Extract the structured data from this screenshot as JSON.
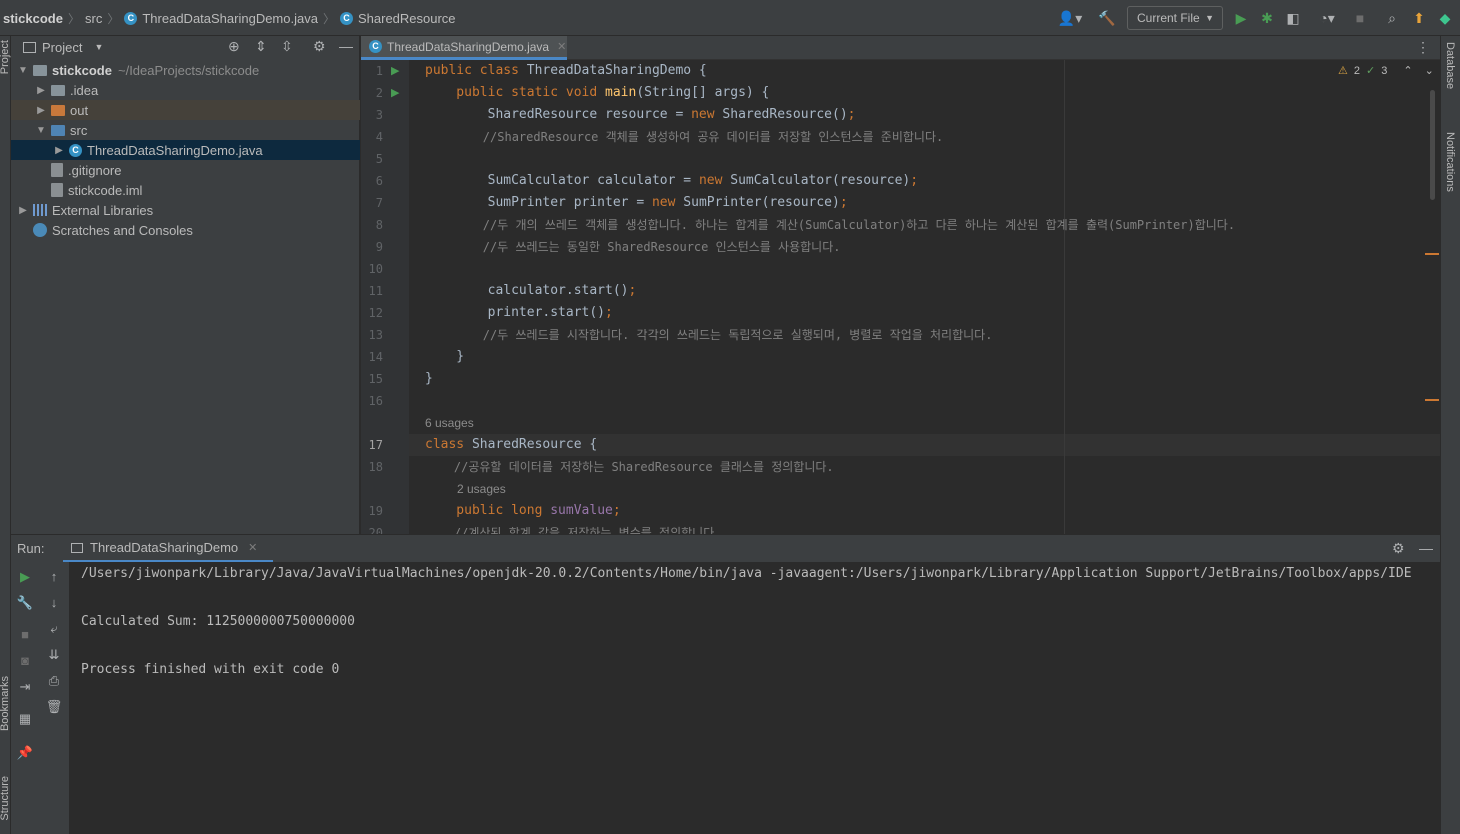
{
  "nav": {
    "project": "stickcode",
    "src": "src",
    "file": "ThreadDataSharingDemo.java",
    "symbol": "SharedResource",
    "run_config": "Current File"
  },
  "left_stripe": {
    "project": "Project",
    "bookmarks": "Bookmarks",
    "structure": "Structure"
  },
  "right_stripe": {
    "database": "Database",
    "notifications": "Notifications"
  },
  "project_panel": {
    "title": "Project",
    "tree": [
      {
        "label": "stickcode",
        "path": "~/IdeaProjects/stickcode"
      },
      {
        "label": ".idea"
      },
      {
        "label": "out"
      },
      {
        "label": "src"
      },
      {
        "label": "ThreadDataSharingDemo.java"
      },
      {
        "label": ".gitignore"
      },
      {
        "label": "stickcode.iml"
      },
      {
        "label": "External Libraries"
      },
      {
        "label": "Scratches and Consoles"
      }
    ]
  },
  "editor": {
    "tab": "ThreadDataSharingDemo.java",
    "warnings": "2",
    "checks": "3",
    "line_numbers": [
      "1",
      "2",
      "3",
      "4",
      "5",
      "6",
      "7",
      "8",
      "9",
      "10",
      "11",
      "12",
      "13",
      "14",
      "15",
      "16",
      "17",
      "18",
      "19",
      "20"
    ],
    "usages_6": "6 usages",
    "usages_2": "2 usages",
    "code": {
      "l1a": "public class ",
      "l1b": "ThreadDataSharingDemo {",
      "l2a": "    public static void ",
      "l2b": "main",
      "l2c": "(String[] args) {",
      "l3a": "        SharedResource resource = ",
      "l3b": "new ",
      "l3c": "SharedResource()",
      "l3d": ";",
      "l4": "        //SharedResource 객체를 생성하여 공유 데이터를 저장할 인스턴스를 준비합니다.",
      "l6a": "        SumCalculator calculator = ",
      "l6b": "new ",
      "l6c": "SumCalculator(resource)",
      "l6d": ";",
      "l7a": "        SumPrinter printer = ",
      "l7b": "new ",
      "l7c": "SumPrinter(resource)",
      "l7d": ";",
      "l8": "        //두 개의 쓰레드 객체를 생성합니다. 하나는 합계를 계산(SumCalculator)하고 다른 하나는 계산된 합계를 출력(SumPrinter)합니다.",
      "l9": "        //두 쓰레드는 동일한 SharedResource 인스턴스를 사용합니다.",
      "l11a": "        calculator.start()",
      "l11b": ";",
      "l12a": "        printer.start()",
      "l12b": ";",
      "l13": "        //두 쓰레드를 시작합니다. 각각의 쓰레드는 독립적으로 실행되며, 병렬로 작업을 처리합니다.",
      "l14": "    }",
      "l15": "}",
      "l17a": "class ",
      "l17b": "SharedResource {",
      "l18": "    //공유할 데이터를 저장하는 SharedResource 클래스를 정의합니다.",
      "l19a": "    public long ",
      "l19b": "sumValue",
      "l19c": ";",
      "l20": "    //계산된 합계 값을 저장하는 변수를 정의합니다."
    }
  },
  "run": {
    "label": "Run:",
    "tab": "ThreadDataSharingDemo",
    "lines": [
      "/Users/jiwonpark/Library/Java/JavaVirtualMachines/openjdk-20.0.2/Contents/Home/bin/java -javaagent:/Users/jiwonpark/Library/Application Support/JetBrains/Toolbox/apps/IDE",
      "Calculated Sum: 1125000000750000000",
      "Process finished with exit code 0"
    ]
  }
}
